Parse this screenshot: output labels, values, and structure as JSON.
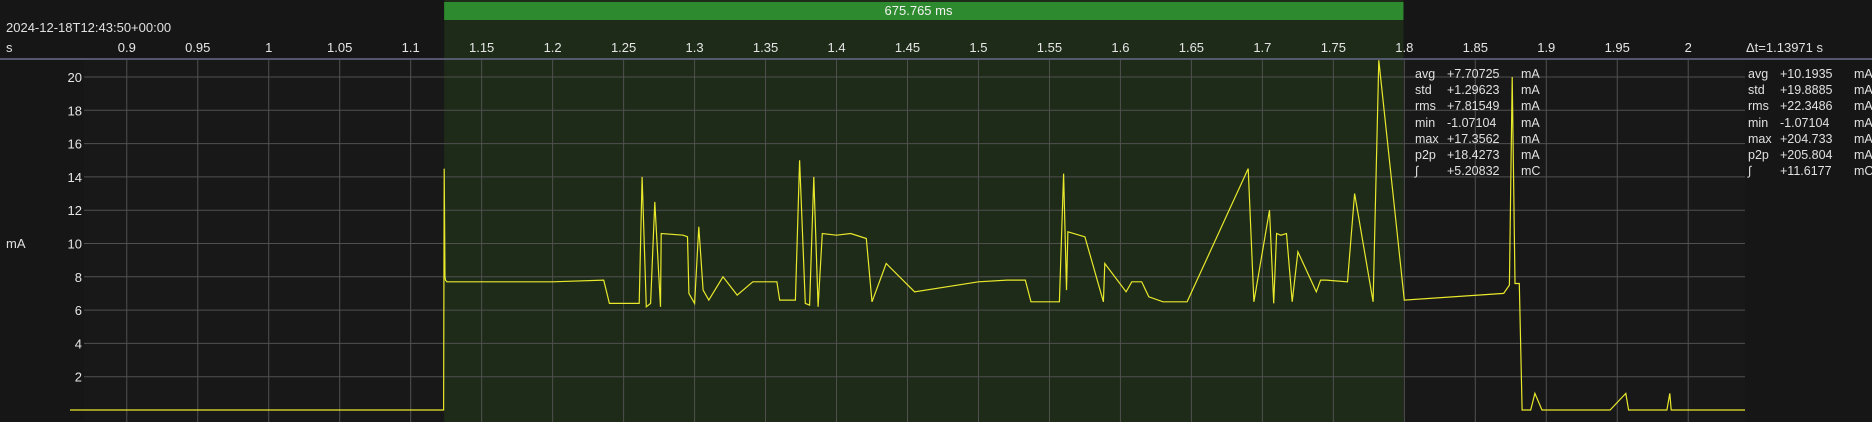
{
  "timestamp": "2024-12-18T12:43:50+00:00",
  "x_unit": "s",
  "y_unit": "mA",
  "selection": {
    "label": "675.765 ms",
    "start": 1.1236,
    "end": 1.7994
  },
  "total": {
    "delta_label": "Δt=1.13971 s"
  },
  "stats_selection": [
    {
      "k": "avg",
      "v": "+7.70725",
      "u": "mA"
    },
    {
      "k": "std",
      "v": "+1.29623",
      "u": "mA"
    },
    {
      "k": "rms",
      "v": "+7.81549",
      "u": "mA"
    },
    {
      "k": "min",
      "v": "-1.07104",
      "u": "mA"
    },
    {
      "k": "max",
      "v": "+17.3562",
      "u": "mA"
    },
    {
      "k": "p2p",
      "v": "+18.4273",
      "u": "mA"
    },
    {
      "k": "∫",
      "v": "+5.20832",
      "u": "mC"
    }
  ],
  "stats_total": [
    {
      "k": "avg",
      "v": "+10.1935",
      "u": "mA"
    },
    {
      "k": "std",
      "v": "+19.8885",
      "u": "mA"
    },
    {
      "k": "rms",
      "v": "+22.3486",
      "u": "mA"
    },
    {
      "k": "min",
      "v": "-1.07104",
      "u": "mA"
    },
    {
      "k": "max",
      "v": "+204.733",
      "u": "mA"
    },
    {
      "k": "p2p",
      "v": "+205.804",
      "u": "mA"
    },
    {
      "k": "∫",
      "v": "+11.6177",
      "u": "mC"
    }
  ],
  "colors": {
    "background": "#161616",
    "plot": "#181818",
    "selection_fill": "#1d2b18",
    "selection_bar": "#2e8a2e",
    "grid": "#505050",
    "trace": "#e8e82c",
    "axis_line": "#6a6a8a"
  },
  "chart_data": {
    "type": "line",
    "xlim": [
      0.86,
      2.04
    ],
    "ylim": [
      0,
      21
    ],
    "x_ticks": [
      "0.9",
      "0.95",
      "1",
      "1.05",
      "1.1",
      "1.15",
      "1.2",
      "1.25",
      "1.3",
      "1.35",
      "1.4",
      "1.45",
      "1.5",
      "1.55",
      "1.6",
      "1.65",
      "1.7",
      "1.75",
      "1.8",
      "1.85",
      "1.9",
      "1.95",
      "2"
    ],
    "y_ticks": [
      "2",
      "4",
      "6",
      "8",
      "10",
      "12",
      "14",
      "16",
      "18",
      "20"
    ],
    "x_tick_values": [
      0.9,
      0.95,
      1,
      1.05,
      1.1,
      1.15,
      1.2,
      1.25,
      1.3,
      1.35,
      1.4,
      1.45,
      1.5,
      1.55,
      1.6,
      1.65,
      1.7,
      1.75,
      1.8,
      1.85,
      1.9,
      1.95,
      2
    ],
    "y_tick_values": [
      2,
      4,
      6,
      8,
      10,
      12,
      14,
      16,
      18,
      20
    ],
    "series": [
      {
        "x": [
          0.86,
          1.1232,
          1.1236,
          1.1242,
          1.1245,
          1.1255,
          1.2,
          1.236,
          1.24,
          1.261,
          1.263,
          1.266,
          1.269,
          1.272,
          1.276,
          1.2765,
          1.292,
          1.295,
          1.296,
          1.3,
          1.303,
          1.306,
          1.31,
          1.32,
          1.33,
          1.341,
          1.345,
          1.358,
          1.36,
          1.371,
          1.374,
          1.378,
          1.381,
          1.384,
          1.387,
          1.39,
          1.4,
          1.41,
          1.421,
          1.425,
          1.435,
          1.455,
          1.5,
          1.52,
          1.533,
          1.537,
          1.55,
          1.557,
          1.56,
          1.562,
          1.563,
          1.571,
          1.575,
          1.588,
          1.589,
          1.604,
          1.608,
          1.615,
          1.62,
          1.63,
          1.643,
          1.647,
          1.69,
          1.694,
          1.705,
          1.708,
          1.71,
          1.713,
          1.717,
          1.721,
          1.725,
          1.738,
          1.741,
          1.745,
          1.76,
          1.765,
          1.778,
          1.782,
          1.8,
          1.87,
          1.874,
          1.876,
          1.878,
          1.881,
          1.883,
          1.887,
          1.889,
          1.892,
          1.897,
          1.9,
          1.945,
          1.956,
          1.958,
          1.962,
          1.985,
          1.987,
          1.988,
          1.989,
          2.04
        ],
        "y": [
          0,
          0,
          14.5,
          8,
          7.8,
          7.7,
          7.7,
          7.8,
          6.4,
          6.4,
          14,
          6.2,
          6.4,
          12.5,
          6.2,
          10.6,
          10.5,
          10.4,
          7,
          6.4,
          11,
          7.2,
          6.6,
          8,
          6.9,
          7.7,
          7.7,
          7.7,
          6.6,
          6.6,
          15,
          6.4,
          6.3,
          14,
          6.2,
          10.6,
          10.5,
          10.6,
          10.3,
          6.5,
          8.8,
          7.1,
          7.7,
          7.8,
          7.8,
          6.5,
          6.5,
          6.5,
          14.2,
          7.2,
          10.7,
          10.5,
          10.4,
          6.5,
          8.8,
          7.1,
          7.7,
          7.7,
          6.8,
          6.5,
          6.5,
          6.5,
          14.5,
          6.5,
          12,
          6.4,
          10.6,
          10.5,
          10.6,
          6.5,
          9.5,
          7.1,
          7.8,
          7.8,
          7.7,
          13,
          6.5,
          21,
          6.6,
          7,
          7.5,
          20,
          7.6,
          7.6,
          0,
          0,
          0,
          1,
          0,
          0,
          0,
          1,
          0,
          0,
          0,
          1,
          0,
          0,
          0
        ]
      }
    ]
  }
}
